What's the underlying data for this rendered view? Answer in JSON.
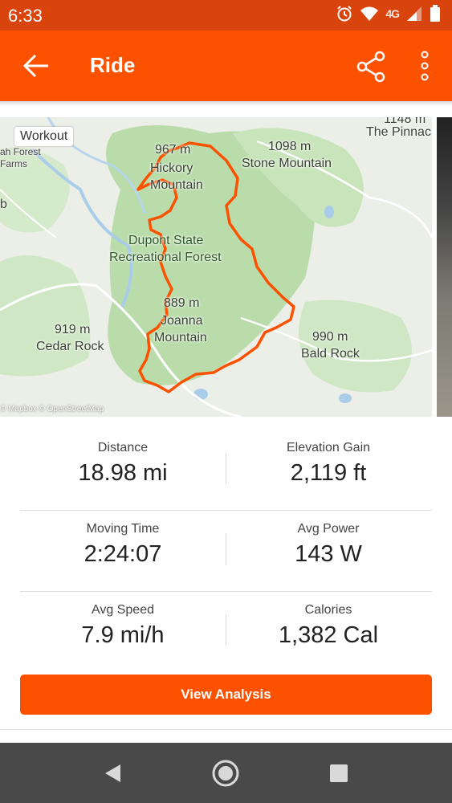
{
  "status_bar": {
    "time": "6:33",
    "network": "4G"
  },
  "app_bar": {
    "title": "Ride"
  },
  "map": {
    "chip": "Workout",
    "labels": {
      "top_right_peak": "1148 m",
      "pinnacle": "The Pinnac",
      "forest_1": "ah Forest",
      "forest_2": "Farms",
      "edge_b": "b",
      "hickory_elev": "967 m",
      "hickory_1": "Hickory",
      "hickory_2": "Mountain",
      "stone_elev": "1098 m",
      "stone_name": "Stone Mountain",
      "dupont_1": "Dupont State",
      "dupont_2": "Recreational Forest",
      "joanna_elev": "889 m",
      "joanna_1": "Joanna",
      "joanna_2": "Mountain",
      "cedar_elev": "919 m",
      "cedar_name": "Cedar Rock",
      "bald_elev": "990 m",
      "bald_name": "Bald Rock"
    },
    "attribution": "© Mapbox © OpenStreetMap",
    "route_color": "#fc5200"
  },
  "stats": [
    {
      "label": "Distance",
      "value": "18.98 mi"
    },
    {
      "label": "Elevation Gain",
      "value": "2,119 ft"
    },
    {
      "label": "Moving Time",
      "value": "2:24:07"
    },
    {
      "label": "Avg Power",
      "value": "143 W"
    },
    {
      "label": "Avg Speed",
      "value": "7.9 mi/h"
    },
    {
      "label": "Calories",
      "value": "1,382 Cal"
    }
  ],
  "cta_label": "View Analysis",
  "colors": {
    "accent": "#fc5200",
    "status_bar": "#d9440c",
    "nav_bar": "#494949"
  },
  "icons": [
    "alarm-icon",
    "wifi-icon",
    "signal-icon",
    "battery-icon",
    "back-arrow-icon",
    "share-icon",
    "more-vert-icon",
    "nav-back-icon",
    "nav-home-icon",
    "nav-recents-icon"
  ]
}
